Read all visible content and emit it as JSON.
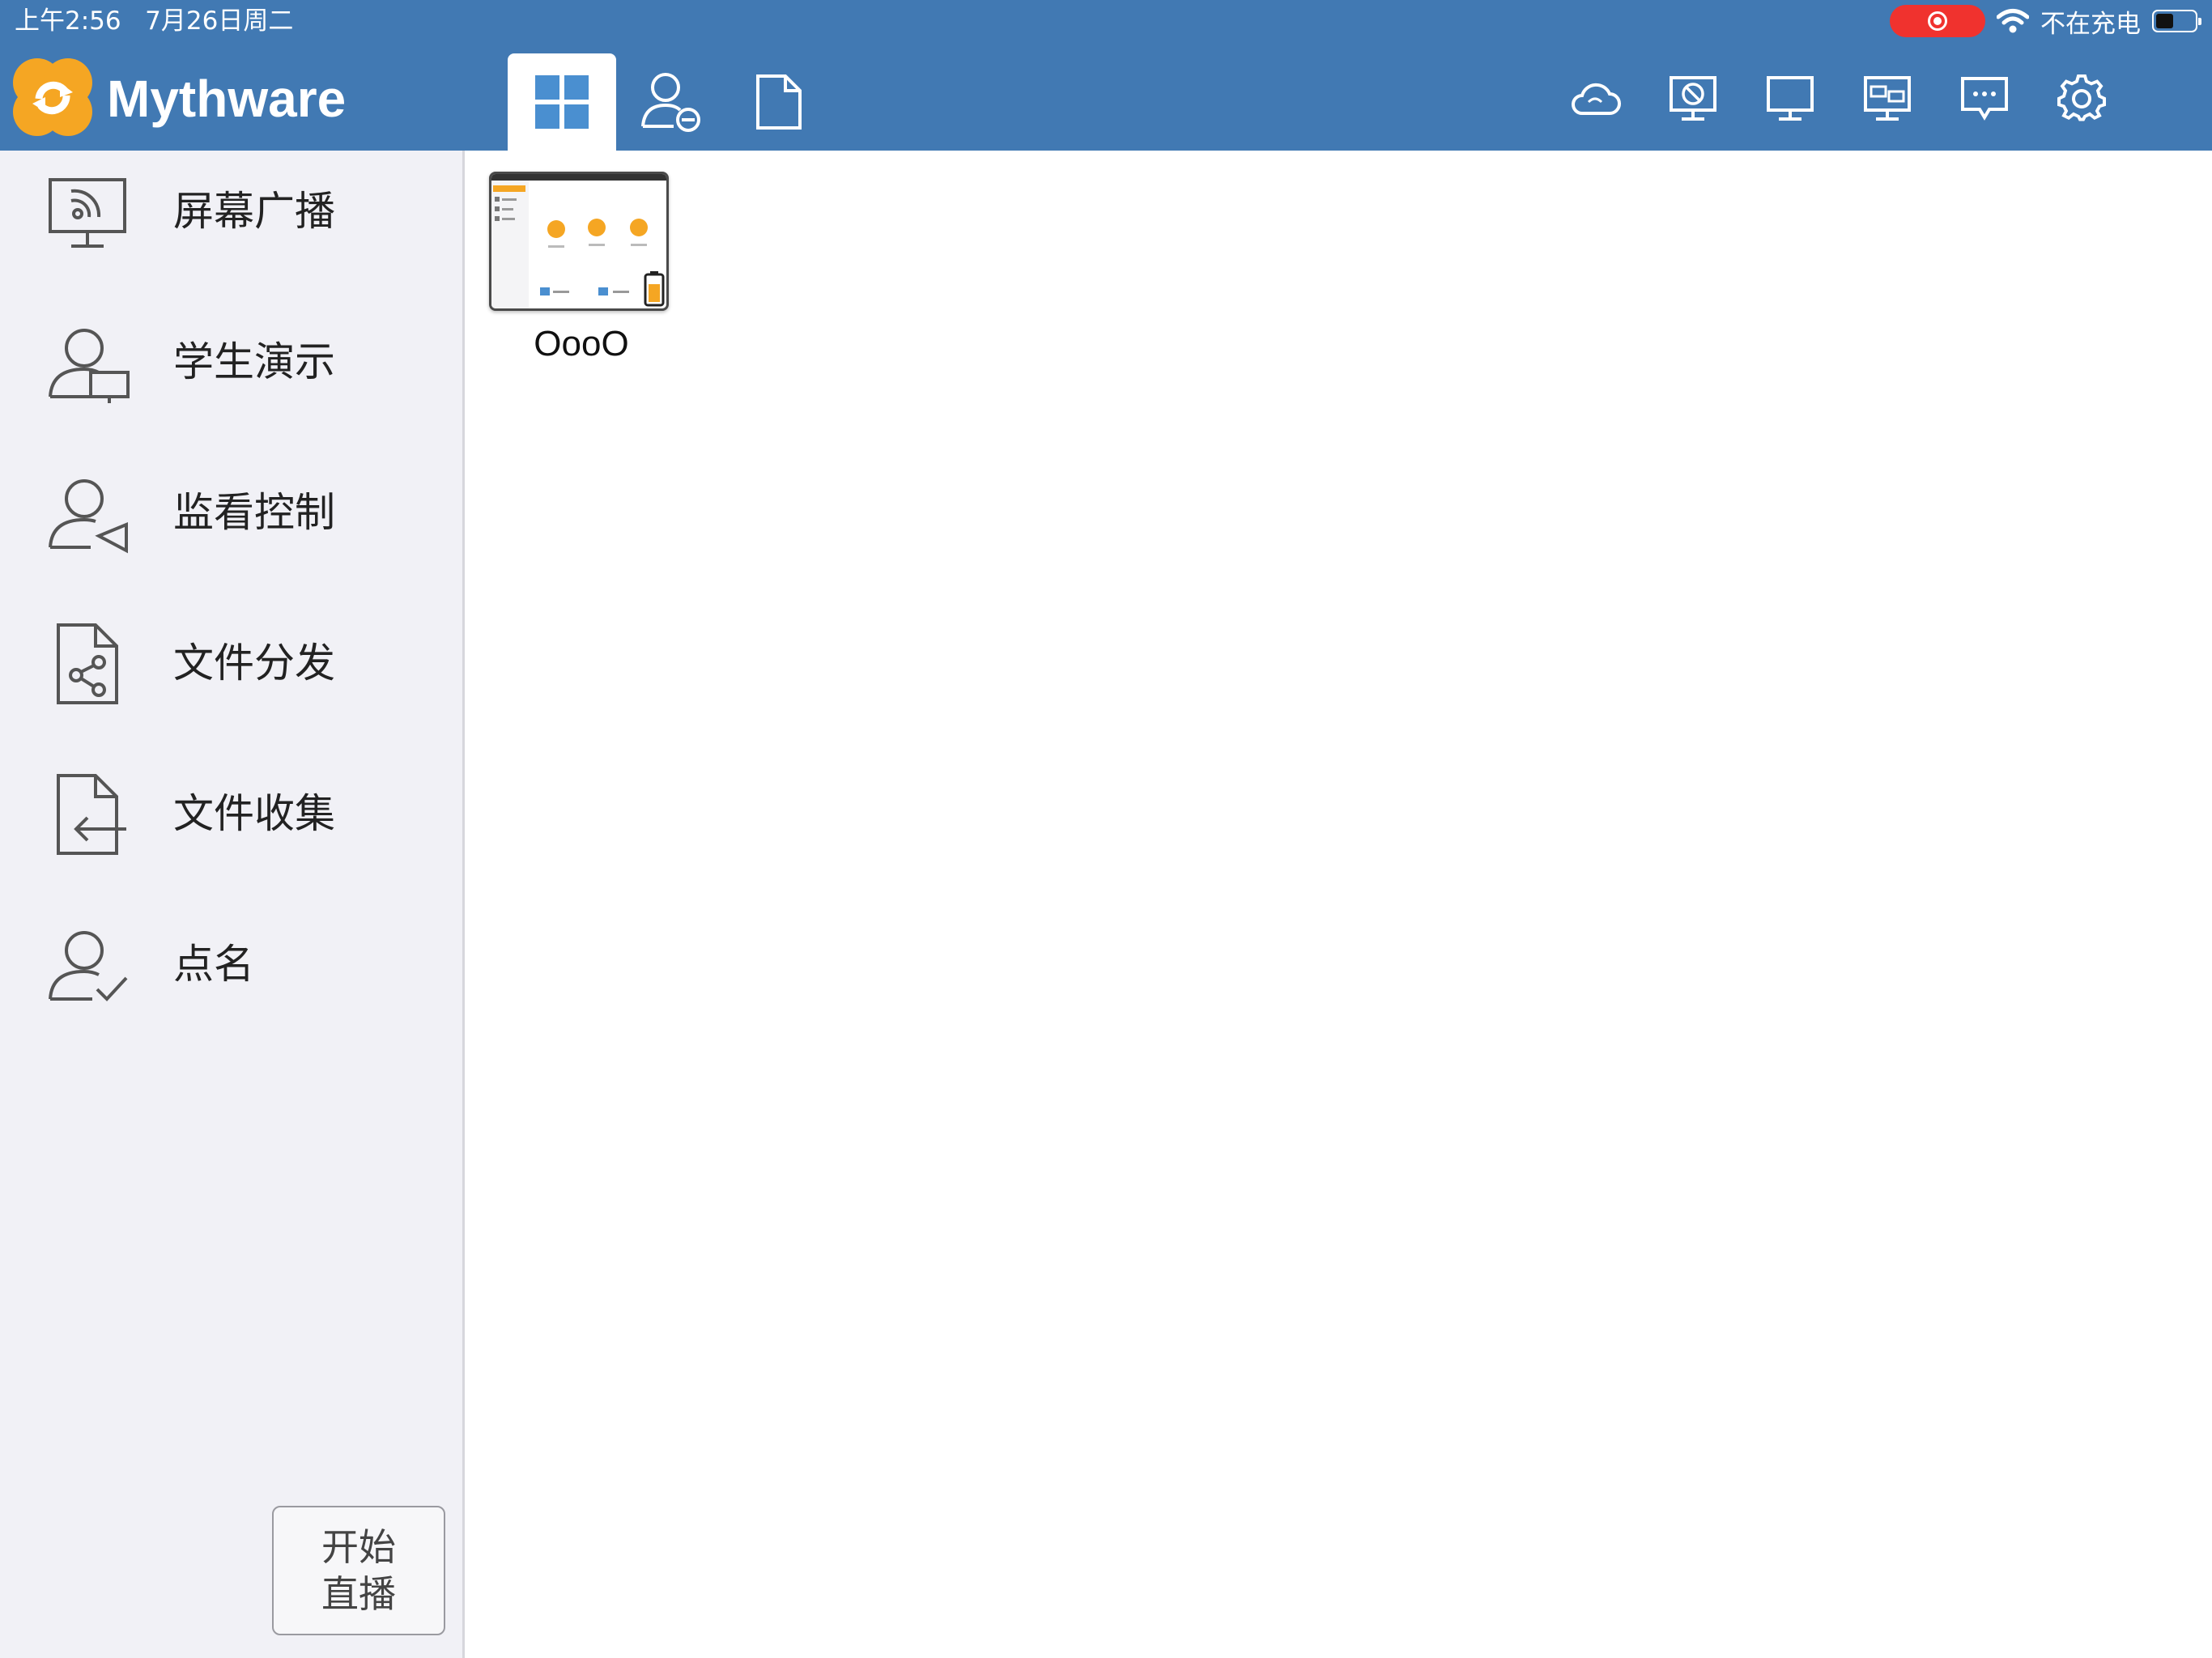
{
  "status_bar": {
    "time": "上午2:56   7月26日周二",
    "charging": "不在充电",
    "battery_level": 0.45
  },
  "header": {
    "brand": "Mythware",
    "tabs": [
      {
        "icon": "grid-icon",
        "active": true
      },
      {
        "icon": "user-minus-icon",
        "active": false
      },
      {
        "icon": "document-icon",
        "active": false
      }
    ],
    "tools": [
      "cloud-icon",
      "screen-lock-icon",
      "monitor-icon",
      "remote-screen-icon",
      "message-icon",
      "gear-icon"
    ]
  },
  "sidebar": {
    "items": [
      {
        "label": "屏幕广播",
        "icon": "screen-broadcast-icon"
      },
      {
        "label": "学生演示",
        "icon": "student-demo-icon"
      },
      {
        "label": "监看控制",
        "icon": "monitor-control-icon"
      },
      {
        "label": "文件分发",
        "icon": "file-share-icon"
      },
      {
        "label": "文件收集",
        "icon": "file-collect-icon"
      },
      {
        "label": "点名",
        "icon": "roll-call-icon"
      }
    ],
    "start_broadcast": {
      "line1": "开始",
      "line2": "直播"
    }
  },
  "main": {
    "students": [
      {
        "name": "OooO"
      }
    ]
  },
  "colors": {
    "header": "#4179b3",
    "accent_orange": "#f5a623",
    "sidebar_bg": "#f1f1f6",
    "record": "#f0322e"
  }
}
